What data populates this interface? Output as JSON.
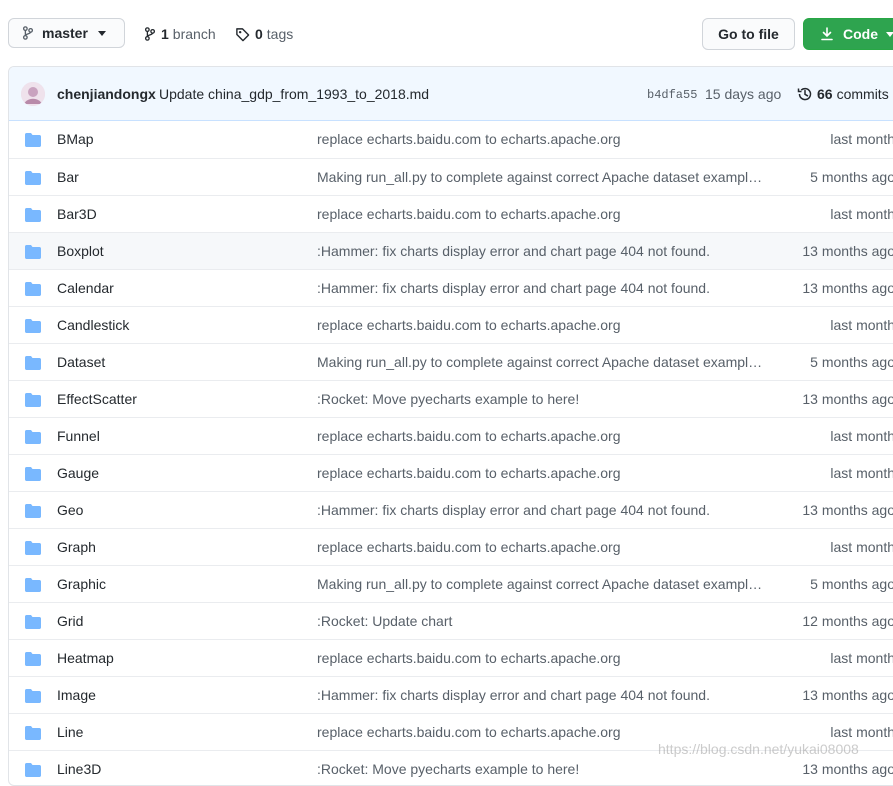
{
  "toolbar": {
    "branch_name": "master",
    "branches_count": "1",
    "branches_label": "branch",
    "tags_count": "0",
    "tags_label": "tags",
    "goto_label": "Go to file",
    "code_label": "Code"
  },
  "commit": {
    "author": "chenjiandongx",
    "message": "Update china_gdp_from_1993_to_2018.md",
    "sha": "b4dfa55",
    "time": "15 days ago",
    "count": "66",
    "count_label": "commits"
  },
  "files": [
    {
      "name": "BMap",
      "message": "replace echarts.baidu.com to echarts.apache.org",
      "age": "last month"
    },
    {
      "name": "Bar",
      "message": "Making run_all.py to complete against correct Apache dataset exampl…",
      "age": "5 months ago"
    },
    {
      "name": "Bar3D",
      "message": "replace echarts.baidu.com to echarts.apache.org",
      "age": "last month"
    },
    {
      "name": "Boxplot",
      "message": ":Hammer: fix charts display error and chart page 404 not found.",
      "age": "13 months ago"
    },
    {
      "name": "Calendar",
      "message": ":Hammer: fix charts display error and chart page 404 not found.",
      "age": "13 months ago"
    },
    {
      "name": "Candlestick",
      "message": "replace echarts.baidu.com to echarts.apache.org",
      "age": "last month"
    },
    {
      "name": "Dataset",
      "message": "Making run_all.py to complete against correct Apache dataset exampl…",
      "age": "5 months ago"
    },
    {
      "name": "EffectScatter",
      "message": ":Rocket: Move pyecharts example to here!",
      "age": "13 months ago"
    },
    {
      "name": "Funnel",
      "message": "replace echarts.baidu.com to echarts.apache.org",
      "age": "last month"
    },
    {
      "name": "Gauge",
      "message": "replace echarts.baidu.com to echarts.apache.org",
      "age": "last month"
    },
    {
      "name": "Geo",
      "message": ":Hammer: fix charts display error and chart page 404 not found.",
      "age": "13 months ago"
    },
    {
      "name": "Graph",
      "message": "replace echarts.baidu.com to echarts.apache.org",
      "age": "last month"
    },
    {
      "name": "Graphic",
      "message": "Making run_all.py to complete against correct Apache dataset exampl…",
      "age": "5 months ago"
    },
    {
      "name": "Grid",
      "message": ":Rocket: Update chart",
      "age": "12 months ago"
    },
    {
      "name": "Heatmap",
      "message": "replace echarts.baidu.com to echarts.apache.org",
      "age": "last month"
    },
    {
      "name": "Image",
      "message": ":Hammer: fix charts display error and chart page 404 not found.",
      "age": "13 months ago"
    },
    {
      "name": "Line",
      "message": "replace echarts.baidu.com to echarts.apache.org",
      "age": "last month"
    },
    {
      "name": "Line3D",
      "message": ":Rocket: Move pyecharts example to here!",
      "age": "13 months ago"
    }
  ],
  "watermark": "https://blog.csdn.net/yukai08008",
  "colors": {
    "folder": "#79b8ff",
    "code_button": "#2ea44f",
    "commit_bar": "#f1f8ff"
  }
}
